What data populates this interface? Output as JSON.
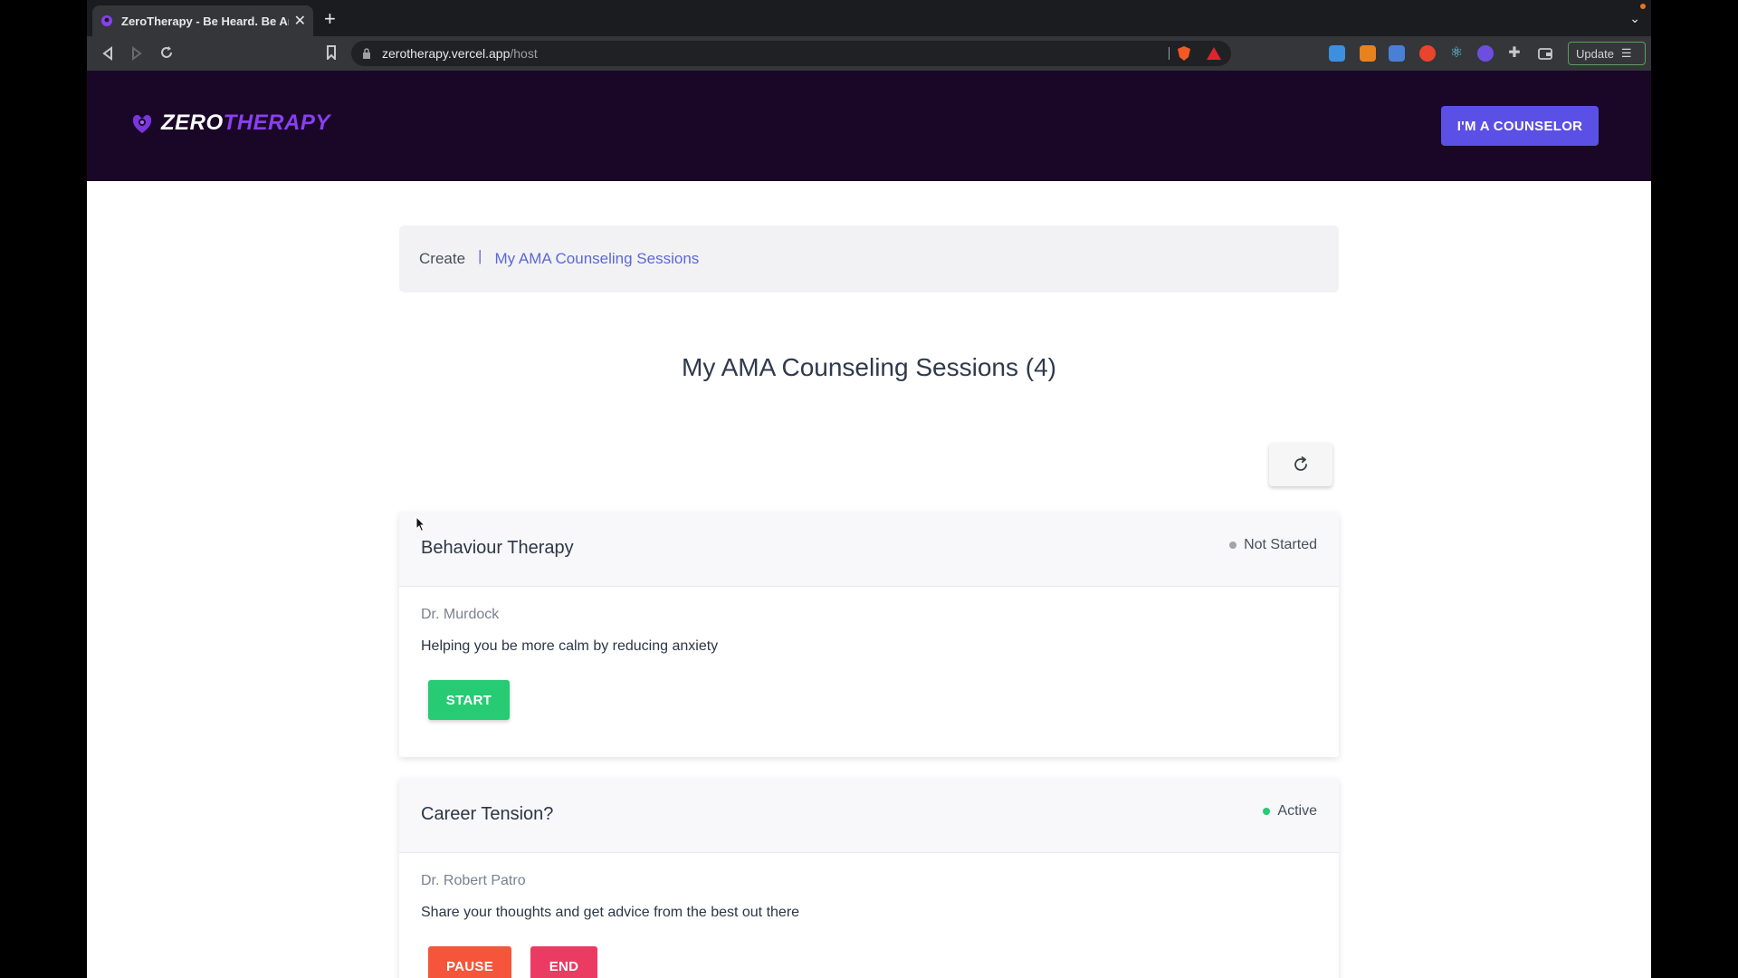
{
  "browser": {
    "tab_title": "ZeroTherapy - Be Heard. Be An",
    "url_host": "zerotherapy.vercel.app",
    "url_path": "/host",
    "update_label": "Update"
  },
  "header": {
    "logo_zero": "ZERO",
    "logo_therapy": "THERAPY",
    "counselor_button": "I'M A COUNSELOR"
  },
  "breadcrumb": {
    "create": "Create",
    "separator": "|",
    "current": "My AMA Counseling Sessions"
  },
  "page_title": "My AMA Counseling Sessions (4)",
  "sessions": [
    {
      "title": "Behaviour Therapy",
      "status": "Not Started",
      "status_color": "#a0a4ab",
      "doctor": "Dr. Murdock",
      "description": "Helping you be more calm by reducing anxiety",
      "buttons": [
        "START"
      ]
    },
    {
      "title": "Career Tension?",
      "status": "Active",
      "status_color": "#26cb74",
      "doctor": "Dr. Robert Patro",
      "description": "Share your thoughts and get advice from the best out there",
      "buttons": [
        "PAUSE",
        "END"
      ]
    }
  ],
  "colors": {
    "header_bg": "#1a0727",
    "brand_purple": "#8a3ff0",
    "primary_button": "#5a50e6",
    "start_green": "#26cb74",
    "pause_orange": "#f5553a",
    "end_red": "#ec3b62"
  },
  "icons": {
    "refresh": "refresh-icon",
    "logo": "zerotherapy-logo-icon"
  }
}
